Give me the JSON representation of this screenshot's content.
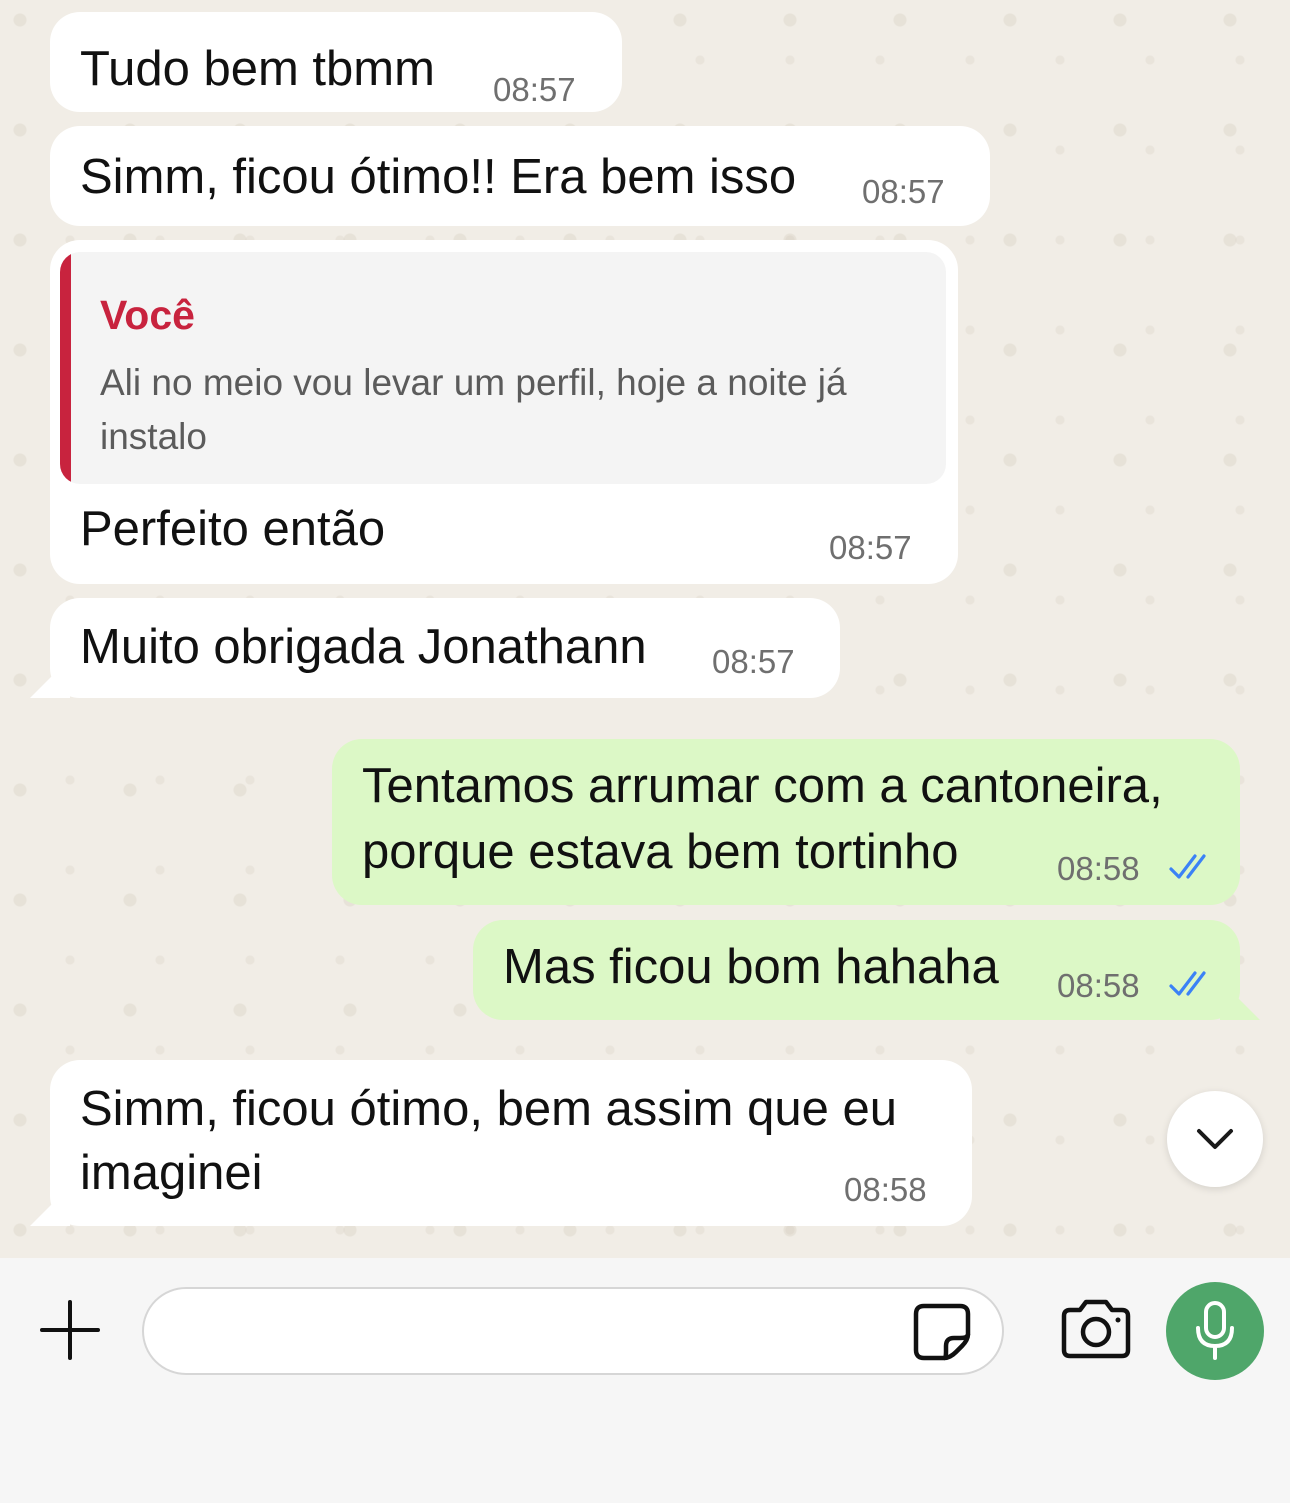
{
  "messages": [
    {
      "direction": "incoming",
      "text": "Tudo bem tbmm",
      "time": "08:57"
    },
    {
      "direction": "incoming",
      "text": "Simm, ficou ótimo!! Era bem isso",
      "time": "08:57"
    },
    {
      "direction": "incoming",
      "reply": {
        "author": "Você",
        "text": "Ali no meio vou levar um perfil, hoje a noite já instalo"
      },
      "text": "Perfeito então",
      "time": "08:57"
    },
    {
      "direction": "incoming",
      "text": "Muito obrigada Jonathann",
      "time": "08:57"
    },
    {
      "direction": "outgoing",
      "line1": "Tentamos arrumar com a cantoneira,",
      "line2": "porque estava bem tortinho",
      "time": "08:58",
      "status": "read"
    },
    {
      "direction": "outgoing",
      "text": "Mas ficou bom hahaha",
      "time": "08:58",
      "status": "read"
    },
    {
      "direction": "incoming",
      "line1": "Simm, ficou ótimo, bem assim que eu",
      "line2": "imaginei",
      "time": "08:58"
    }
  ],
  "colors": {
    "incoming_bubble": "#ffffff",
    "outgoing_bubble": "#dcf8c6",
    "reply_accent": "#c8233e",
    "read_ticks": "#3b82f6",
    "mic_button": "#4fa66a"
  },
  "icons": {
    "scroll_down": "chevron-down-icon",
    "attach": "plus-icon",
    "sticker": "sticker-icon",
    "camera": "camera-icon",
    "mic": "microphone-icon"
  },
  "composer": {
    "value": ""
  }
}
